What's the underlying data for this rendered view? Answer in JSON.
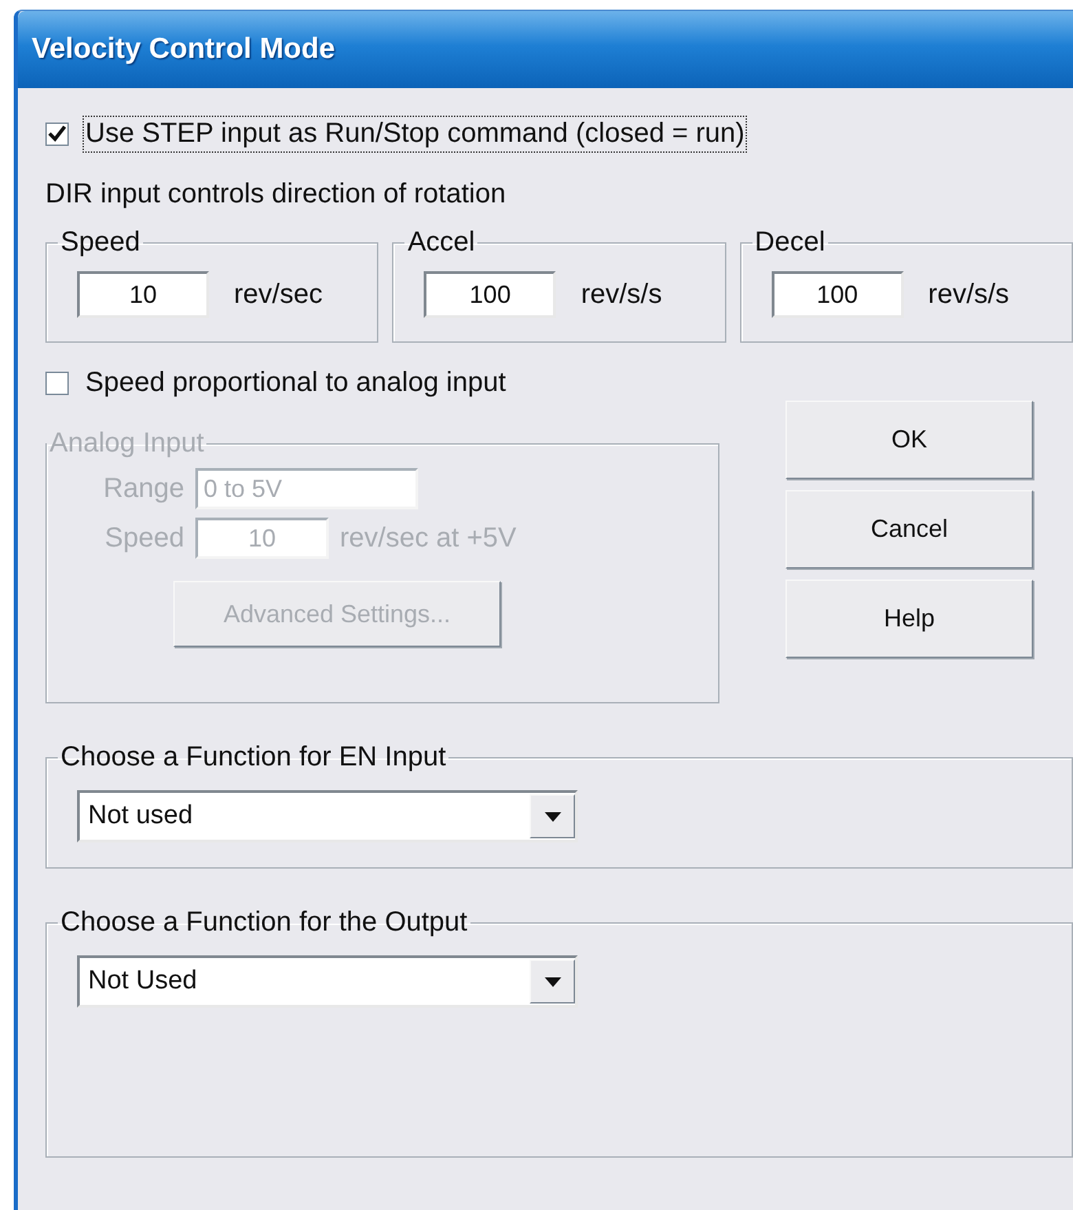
{
  "window": {
    "title": "Velocity Control Mode"
  },
  "run_stop_checkbox": {
    "label": "Use STEP input as Run/Stop command (closed = run)",
    "checked": true,
    "focused": true
  },
  "note": "DIR input controls direction of rotation",
  "motion": [
    {
      "label": "Speed",
      "value": "10",
      "unit": "rev/sec"
    },
    {
      "label": "Accel",
      "value": "100",
      "unit": "rev/s/s"
    },
    {
      "label": "Decel",
      "value": "100",
      "unit": "rev/s/s"
    }
  ],
  "analog_checkbox": {
    "label": "Speed proportional to analog input",
    "checked": false
  },
  "analog_input": {
    "label": "Analog Input",
    "disabled": true,
    "range_label": "Range",
    "range_value": "0 to 5V",
    "speed_label": "Speed",
    "speed_value": "10",
    "speed_unit": "rev/sec at +5V",
    "button": "Advanced Settings..."
  },
  "buttons": [
    "OK",
    "Cancel",
    "Help"
  ],
  "en_input": {
    "label": "Choose a Function for EN Input",
    "value": "Not used"
  },
  "output": {
    "label": "Choose a Function for the Output",
    "value": "Not Used"
  }
}
